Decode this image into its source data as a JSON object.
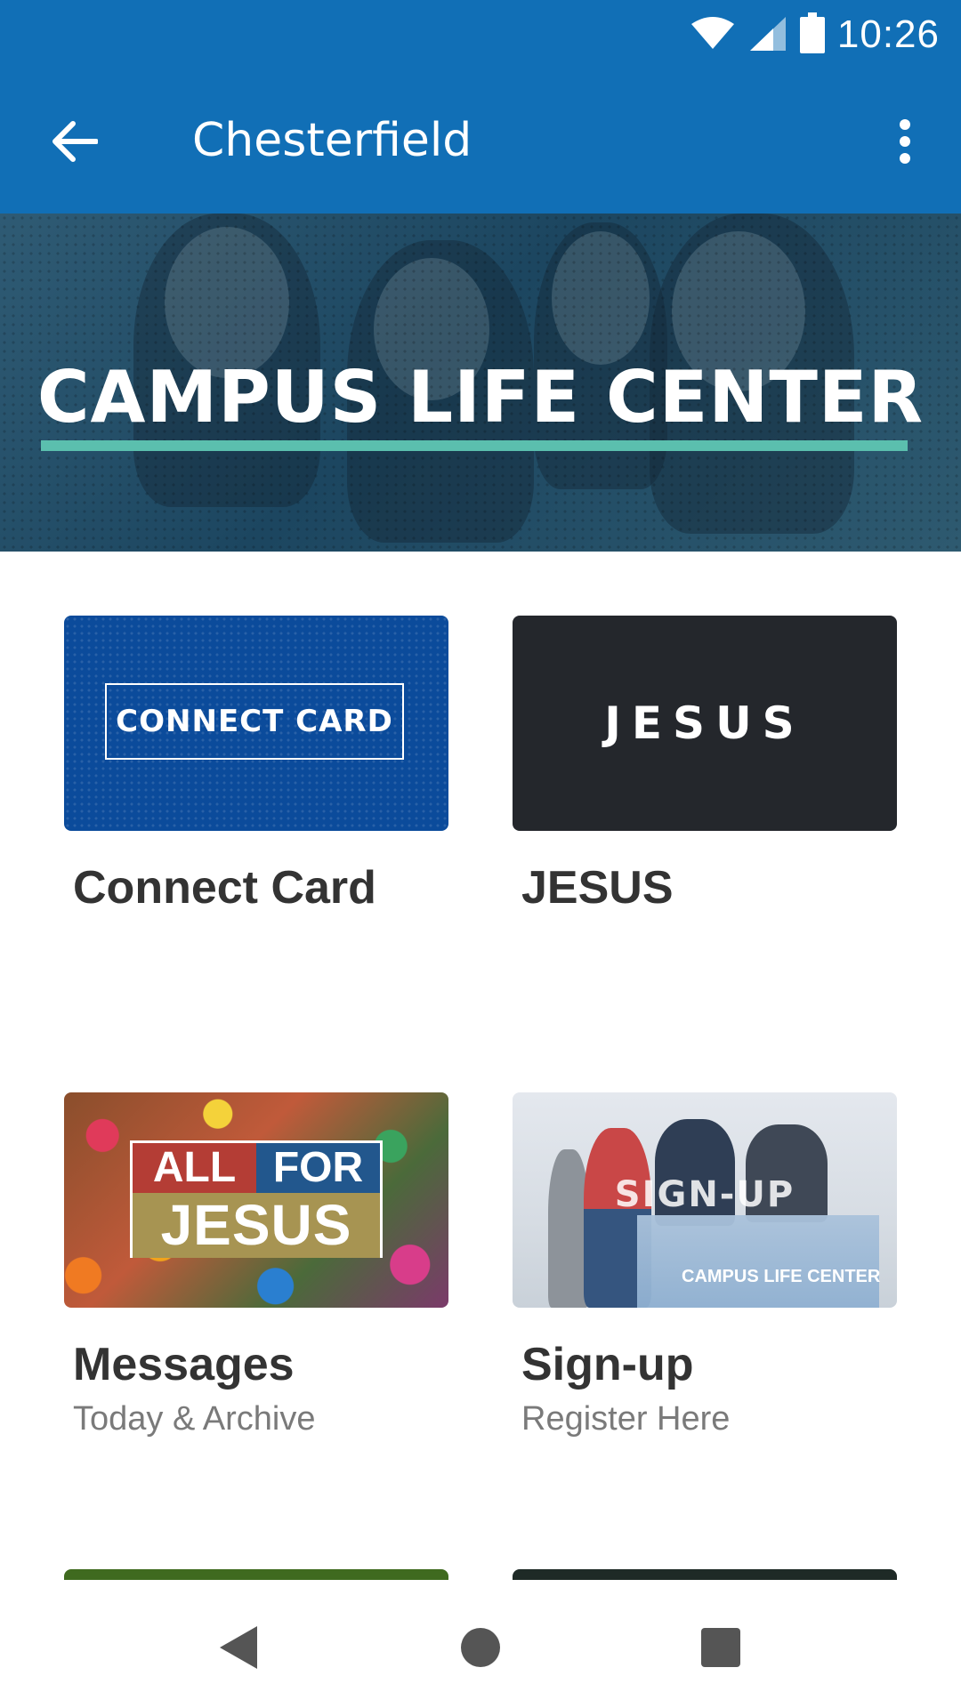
{
  "status_bar": {
    "time": "10:26",
    "icons": [
      "wifi-icon",
      "signal-icon",
      "battery-icon"
    ]
  },
  "app_bar": {
    "title": "Chesterfield",
    "back_icon": "arrow-left-icon",
    "menu_icon": "more-vert-icon"
  },
  "hero": {
    "title": "CAMPUS LIFE CENTER",
    "accent_color": "#5bbfae"
  },
  "tiles": [
    {
      "title": "Connect Card",
      "subtitle": "",
      "thumb_text": "CONNECT CARD"
    },
    {
      "title": "JESUS",
      "subtitle": "",
      "thumb_text": "JESUS"
    },
    {
      "title": "Messages",
      "subtitle": "Today & Archive",
      "thumb_text_top_left": "ALL",
      "thumb_text_top_right": "FOR",
      "thumb_text_bottom": "JESUS"
    },
    {
      "title": "Sign-up",
      "subtitle": "Register Here",
      "thumb_text": "SIGN-UP",
      "thumb_subtext": "CAMPUS LIFE CENTER"
    }
  ],
  "colors": {
    "primary": "#116fb6",
    "connect_blue": "#0b4b9b",
    "dark_tile": "#24272c"
  },
  "nav": {
    "back": "triangle-back-icon",
    "home": "circle-home-icon",
    "recents": "square-recents-icon"
  }
}
